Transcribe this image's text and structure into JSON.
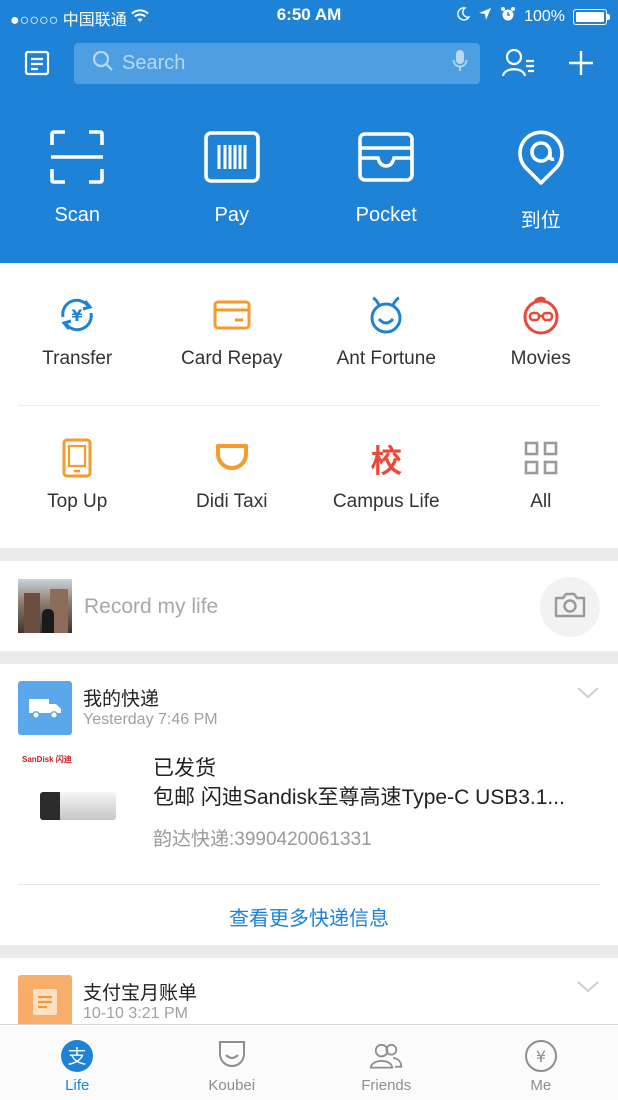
{
  "colors": {
    "primary": "#1e82d6",
    "orange": "#f59a2b",
    "red": "#e74a3b",
    "gray_icon": "#9a9a9a"
  },
  "status_bar": {
    "carrier": "●○○○○ 中国联通",
    "time": "6:50 AM",
    "battery": "100%",
    "icons": [
      "wifi-icon",
      "moon-icon",
      "location-arrow-icon",
      "alarm-icon",
      "battery-icon"
    ]
  },
  "header": {
    "search_placeholder": "Search",
    "icons": [
      "bill-list-icon",
      "search-icon",
      "microphone-icon",
      "contacts-icon",
      "plus-icon"
    ]
  },
  "quick_actions": [
    {
      "label": "Scan",
      "icon": "scan-icon"
    },
    {
      "label": "Pay",
      "icon": "barcode-icon"
    },
    {
      "label": "Pocket",
      "icon": "wallet-icon"
    },
    {
      "label": "到位",
      "icon": "location-pin-icon"
    }
  ],
  "services": [
    {
      "label": "Transfer",
      "icon": "transfer-icon"
    },
    {
      "label": "Card Repay",
      "icon": "credit-card-icon"
    },
    {
      "label": "Ant Fortune",
      "icon": "ant-fortune-icon"
    },
    {
      "label": "Movies",
      "icon": "movies-icon"
    },
    {
      "label": "Top Up",
      "icon": "phone-topup-icon"
    },
    {
      "label": "Didi Taxi",
      "icon": "didi-icon"
    },
    {
      "label": "Campus Life",
      "icon": "campus-icon",
      "glyph": "校"
    },
    {
      "label": "All",
      "icon": "grid-all-icon"
    }
  ],
  "record": {
    "placeholder": "Record my life"
  },
  "express_card": {
    "title": "我的快递",
    "time": "Yesterday 7:46 PM",
    "product_brand": "SanDisk 闪迪",
    "status": "已发货",
    "description": "包邮 闪迪Sandisk至尊高速Type-C USB3.1...",
    "tracking": "韵达快递:3990420061331",
    "more_link": "查看更多快递信息"
  },
  "bill_card": {
    "title": "支付宝月账单",
    "time": "10-10 3:21 PM"
  },
  "tabs": [
    {
      "label": "Life",
      "icon": "life-icon",
      "active": true
    },
    {
      "label": "Koubei",
      "icon": "koubei-icon",
      "active": false
    },
    {
      "label": "Friends",
      "icon": "friends-icon",
      "active": false
    },
    {
      "label": "Me",
      "icon": "me-icon",
      "active": false
    }
  ]
}
